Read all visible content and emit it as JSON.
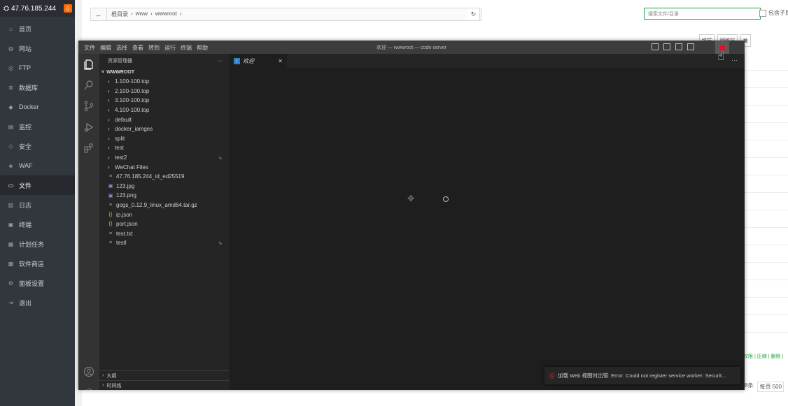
{
  "sidebar": {
    "host": "47.76.185.244",
    "badge": "0",
    "items": [
      {
        "label": "首页",
        "icon": "home-icon",
        "glyph": "⌂"
      },
      {
        "label": "网站",
        "icon": "globe-icon",
        "glyph": "◍"
      },
      {
        "label": "FTP",
        "icon": "ftp-icon",
        "glyph": "◎"
      },
      {
        "label": "数据库",
        "icon": "database-icon",
        "glyph": "≣"
      },
      {
        "label": "Docker",
        "icon": "docker-icon",
        "glyph": "◆"
      },
      {
        "label": "监控",
        "icon": "monitor-icon",
        "glyph": "▤"
      },
      {
        "label": "安全",
        "icon": "shield-icon",
        "glyph": "◇"
      },
      {
        "label": "WAF",
        "icon": "waf-icon",
        "glyph": "◈"
      },
      {
        "label": "文件",
        "icon": "folder-icon",
        "glyph": "▭",
        "active": true
      },
      {
        "label": "日志",
        "icon": "log-icon",
        "glyph": "▥"
      },
      {
        "label": "终端",
        "icon": "terminal-icon",
        "glyph": "▣"
      },
      {
        "label": "计划任务",
        "icon": "schedule-icon",
        "glyph": "▦"
      },
      {
        "label": "软件商店",
        "icon": "store-icon",
        "glyph": "▩"
      },
      {
        "label": "面板设置",
        "icon": "settings-icon",
        "glyph": "⚙"
      },
      {
        "label": "退出",
        "icon": "logout-icon",
        "glyph": "⇥"
      }
    ]
  },
  "filemanager": {
    "crumbs": [
      "根目录",
      "www",
      "wwwroot"
    ],
    "search_placeholder": "搜索文件/目录",
    "subdir_label": "包含子目",
    "tools": [
      "终端",
      "回收站"
    ],
    "row_actions": "权限 | 压缩 | 删除 |",
    "paging_total": "8条",
    "paging_per": "每页 500"
  },
  "codeserver": {
    "menu": [
      "文件",
      "编辑",
      "选择",
      "查看",
      "转到",
      "运行",
      "终端",
      "帮助"
    ],
    "title": "欢迎 — wwwroot — code-server",
    "explorer_title": "资源管理器",
    "root": "WWWROOT",
    "tree": [
      {
        "name": "1.100-100.top",
        "type": "folder"
      },
      {
        "name": "2.100-100.top",
        "type": "folder"
      },
      {
        "name": "3.100-100.top",
        "type": "folder"
      },
      {
        "name": "4.100-100.top",
        "type": "folder"
      },
      {
        "name": "default",
        "type": "folder"
      },
      {
        "name": "docker_iamges",
        "type": "folder"
      },
      {
        "name": "split",
        "type": "folder"
      },
      {
        "name": "test",
        "type": "folder"
      },
      {
        "name": "test2",
        "type": "folder",
        "mark": "↳"
      },
      {
        "name": "WeChat Files",
        "type": "folder"
      },
      {
        "name": "47.76.185.244_id_ed25519",
        "type": "txt"
      },
      {
        "name": "123.jpg",
        "type": "img"
      },
      {
        "name": "123.png",
        "type": "img"
      },
      {
        "name": "gogs_0.12.9_linux_amd64.tar.gz",
        "type": "txt"
      },
      {
        "name": "ip.json",
        "type": "json"
      },
      {
        "name": "port.json",
        "type": "json"
      },
      {
        "name": "test.txt",
        "type": "txt"
      },
      {
        "name": "testl",
        "type": "txt",
        "mark": "↳"
      }
    ],
    "sections": [
      "大纲",
      "时间线"
    ],
    "tab_label": "欢迎",
    "toast": "加载 Web 视图时出错: Error: Could not register service worker: Securit..."
  }
}
